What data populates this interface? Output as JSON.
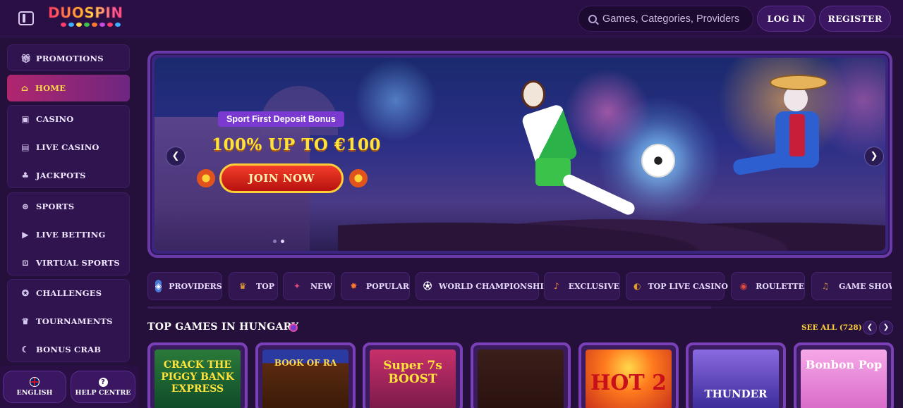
{
  "header": {
    "logo_text": "DUOSPIN",
    "search_placeholder": "Games, Categories, Providers",
    "login_label": "LOG IN",
    "register_label": "REGISTER"
  },
  "sidebar": {
    "promotions": "PROMOTIONS",
    "home": "HOME",
    "casino": "CASINO",
    "live_casino": "LIVE CASINO",
    "jackpots": "JACKPOTS",
    "sports": "SPORTS",
    "live_betting": "LIVE BETTING",
    "virtual_sports": "VIRTUAL SPORTS",
    "challenges": "CHALLENGES",
    "tournaments": "TOURNAMENTS",
    "bonus_crab": "BONUS CRAB",
    "language": "ENGLISH",
    "help": "HELP CENTRE"
  },
  "banner": {
    "tag": "Sport First Deposit Bonus",
    "headline": "100% UP TO €100",
    "cta": "JOIN NOW",
    "slide_count": 2,
    "active_slide": 2
  },
  "categories": [
    {
      "label": "PROVIDERS",
      "icon": "providers-icon",
      "color": "#4a7ad8"
    },
    {
      "label": "TOP",
      "icon": "trophy-icon",
      "color": "#ffb02e"
    },
    {
      "label": "NEW",
      "icon": "new-icon",
      "color": "#e04a7a"
    },
    {
      "label": "POPULAR",
      "icon": "popular-icon",
      "color": "#ff7a2e"
    },
    {
      "label": "WORLD CHAMPIONSHIP",
      "icon": "football-icon",
      "color": "#ffffff"
    },
    {
      "label": "EXCLUSIVE",
      "icon": "maracas-icon",
      "color": "#ff8a2e"
    },
    {
      "label": "TOP LIVE CASINO",
      "icon": "live-casino-icon",
      "color": "#e0a020"
    },
    {
      "label": "ROULETTE",
      "icon": "roulette-icon",
      "color": "#e04a3a"
    },
    {
      "label": "GAME SHOW",
      "icon": "guitar-icon",
      "color": "#c88a3a"
    }
  ],
  "section": {
    "title": "TOP GAMES IN HUNGARY",
    "see_all": "SEE ALL (728)"
  },
  "games": [
    {
      "title": "CRACK THE PIGGY BANK EXPRESS",
      "color": "#1a6a3a",
      "text_color": "#ffe23a"
    },
    {
      "title": "BOOK OF RA",
      "color": "#4a2a10",
      "text_color": "#ffd84a"
    },
    {
      "title": "Super 7s BOOST",
      "color": "#8a1a5a",
      "text_color": "#ffe23a"
    },
    {
      "title": "",
      "color": "#3a1a1a",
      "text_color": "#ffffff"
    },
    {
      "title": "HOT 2",
      "color": "#c8401a",
      "text_color": "#ffe23a"
    },
    {
      "title": "THUNDER",
      "color": "#5a3ab8",
      "text_color": "#ffffff"
    },
    {
      "title": "Bonbon Pop",
      "color": "#e87ad0",
      "text_color": "#ffffff"
    }
  ]
}
